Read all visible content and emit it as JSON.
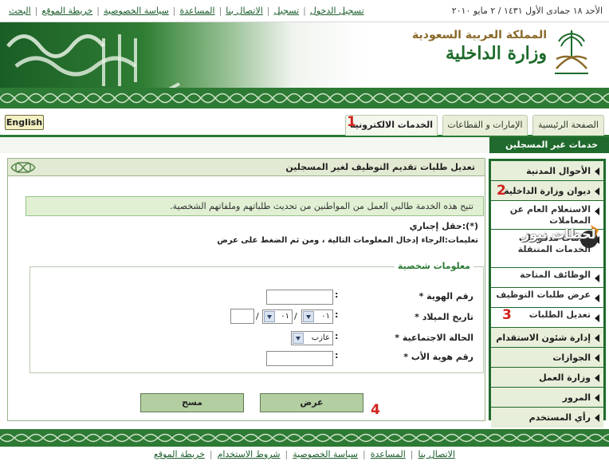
{
  "topbar": {
    "date": "الأحد ١٨ جمادى الأول ١٤٣١ / ٢ مايو ٢٠١٠",
    "links": [
      "تسجيل الدخول",
      "تسجيل",
      "الاتصال بنا",
      "المساعدة",
      "سياسة الخصوصية",
      "خريطة الموقع",
      "البحث"
    ]
  },
  "banner": {
    "kingdom": "المملكة العربية السعودية",
    "ministry": "وزارة الداخلية"
  },
  "nav": {
    "tabs": [
      "الصفحة الرئيسية",
      "الإمارات و القطاعات",
      "الخدمات الالكترونية"
    ],
    "english": "English"
  },
  "section": {
    "label": "خدمات غير المسجلين"
  },
  "sidebar": {
    "items": [
      "الأحوال المدنية",
      "ديوان وزارة الداخلية",
      "الاستعلام العام عن المعاملات",
      "خدمات مدفوعات الخدمات المتنقلة",
      "الوظائف المتاحة",
      "عرض طلبات التوظيف",
      "تعديل الطلبات",
      "إدارة شئون الاستقدام",
      "الجوازات",
      "وزارة العمل",
      "المرور",
      "رأي المستخدم"
    ]
  },
  "panel": {
    "title": "تعديل طلبات تقديم التوظيف لغير المسجلين",
    "notice": "تتيح هذه الخدمة طالبي العمل من المواطنين من تحديث طلباتهم وملفاتهم الشخصية.",
    "required": "(*):حقل إجباري",
    "instructions": "تعليمات:الرجاء إدخال المعلومات التالية ، ومن ثم الضغط على عرض",
    "fieldset_title": "معلومات شخصية",
    "fields": {
      "id_label": "رقم الهوية *",
      "dob_label": "تاريخ الميلاد *",
      "marital_label": "الحالة الاجتماعية *",
      "father_id_label": "رقم هوية الأب *"
    },
    "dob_day": "٠١",
    "dob_month": "٠١",
    "marital_value": "عازب",
    "buttons": {
      "show": "عرض",
      "clear": "مسح"
    }
  },
  "markers": [
    "1",
    "2",
    "3",
    "4"
  ],
  "watermark": "لحظات نيوز",
  "footer": {
    "links": [
      "الاتصال بنا",
      "المساعدة",
      "سياسة الخصوصية",
      "شروط الاستخدام",
      "خريطة الموقع"
    ]
  },
  "colors": {
    "brand_green": "#1f6a2c",
    "marker_red": "#d1221e"
  }
}
